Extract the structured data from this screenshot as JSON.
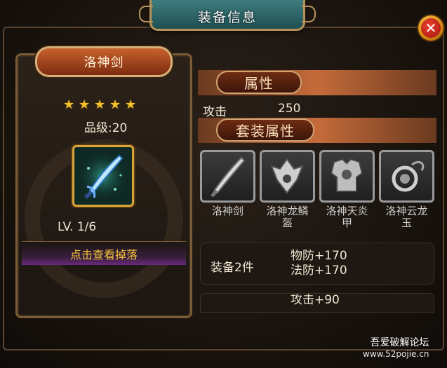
{
  "header": {
    "title": "装备信息"
  },
  "close": {
    "icon": "close-icon",
    "glyph": "✕"
  },
  "item": {
    "name": "洛神剑",
    "stars": 5,
    "star_glyph": "★",
    "grade_label": "品级:20",
    "level_label": "LV. 1/6",
    "drop_button": "点击查看掉落"
  },
  "attributes": {
    "section_title": "属性",
    "rows": [
      {
        "name": "攻击",
        "value": "250"
      }
    ]
  },
  "suit": {
    "section_title": "套装属性",
    "items": [
      {
        "name": "洛神剑"
      },
      {
        "name": "洛神龙鳞盔"
      },
      {
        "name": "洛神天炎甲"
      },
      {
        "name": "洛神云龙玉"
      }
    ],
    "bonus": {
      "label": "装备2件",
      "lines": [
        "物防+170",
        "法防+170"
      ]
    },
    "bonus2_partial": "攻击+90"
  },
  "watermark": {
    "line1": "吾爱破解论坛",
    "line2": "www.52pojie.cn"
  },
  "colors": {
    "star": "#f4c12c",
    "accent": "#d9a53a",
    "header": "#2f6a6c"
  }
}
